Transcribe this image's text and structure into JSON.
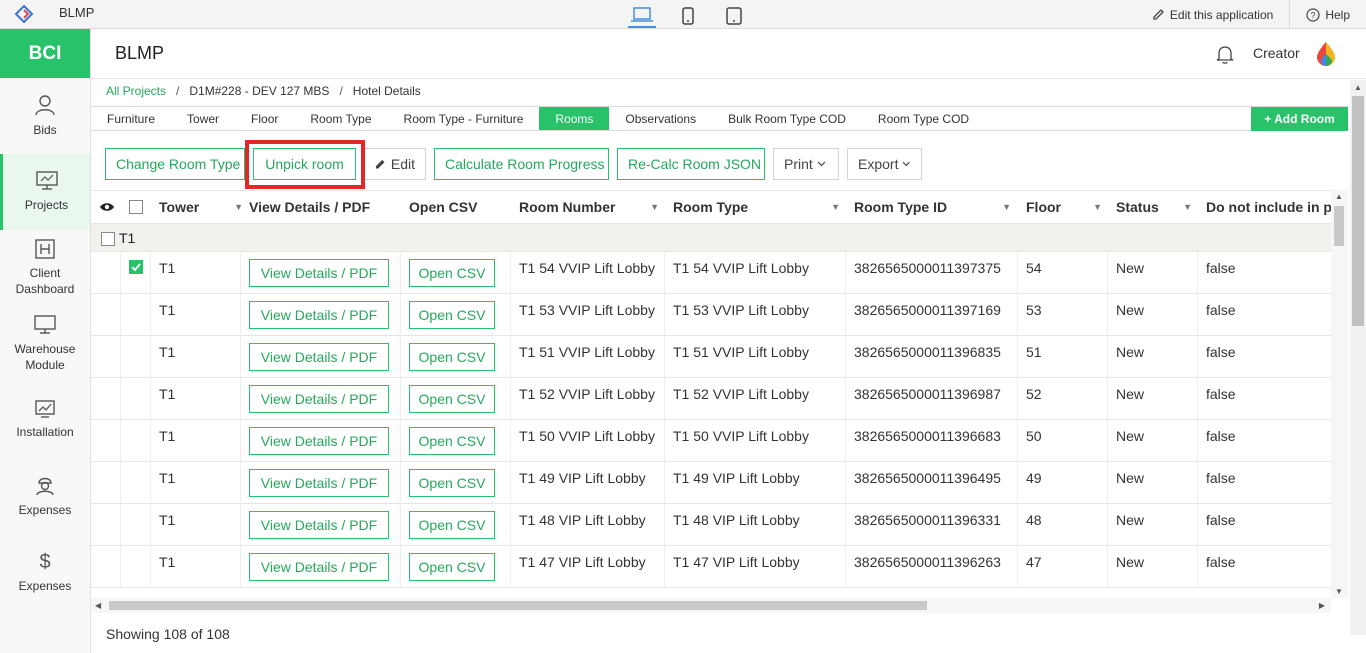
{
  "app": {
    "name": "BLMP"
  },
  "topbar": {
    "edit_label": "Edit this application",
    "help_label": "Help"
  },
  "sidebar": {
    "brand": "BCI",
    "items": [
      {
        "label": "Bids",
        "icon": "user-icon"
      },
      {
        "label": "Projects",
        "icon": "monitor-icon",
        "active": true
      },
      {
        "label": "Client\nDashboard",
        "icon": "h-box-icon"
      },
      {
        "label": "Warehouse\nModule",
        "icon": "monitor-icon"
      },
      {
        "label": "Installation",
        "icon": "chart-icon"
      },
      {
        "label": "Expenses",
        "icon": "worker-icon"
      },
      {
        "label": "Expenses",
        "icon": "dollar-icon"
      }
    ]
  },
  "header": {
    "title": "BLMP",
    "user": "Creator"
  },
  "breadcrumb": {
    "root": "All Projects",
    "project": "D1M#228 - DEV 127 MBS",
    "page": "Hotel Details"
  },
  "tabs": [
    "Furniture",
    "Tower",
    "Floor",
    "Room Type",
    "Room Type - Furniture",
    "Rooms",
    "Observations",
    "Bulk Room Type COD",
    "Room Type COD"
  ],
  "active_tab": "Rooms",
  "add_room_label": "+ Add Room",
  "toolbar": {
    "change_room_type": "Change Room Type",
    "unpick_room": "Unpick room",
    "edit": "Edit",
    "calculate_progress": "Calculate Room Progress",
    "recalc_json": "Re-Calc Room JSON",
    "print": "Print",
    "export": "Export"
  },
  "grid": {
    "columns": [
      "Tower",
      "View Details / PDF",
      "Open CSV",
      "Room Number",
      "Room Type",
      "Room Type ID",
      "Floor",
      "Status",
      "Do not include in pe"
    ],
    "group_label": "T1",
    "view_btn": "View Details / PDF",
    "csv_btn": "Open CSV",
    "rows": [
      {
        "tower": "T1",
        "room_number": "T1 54 VVIP Lift Lobby",
        "room_type": "T1 54 VVIP Lift Lobby",
        "room_type_id": "3826565000011397375",
        "floor": "54",
        "status": "New",
        "exclude": "false",
        "checked": true
      },
      {
        "tower": "T1",
        "room_number": "T1 53 VVIP Lift Lobby",
        "room_type": "T1 53 VVIP Lift Lobby",
        "room_type_id": "3826565000011397169",
        "floor": "53",
        "status": "New",
        "exclude": "false"
      },
      {
        "tower": "T1",
        "room_number": "T1 51 VVIP Lift Lobby",
        "room_type": "T1 51 VVIP Lift Lobby",
        "room_type_id": "3826565000011396835",
        "floor": "51",
        "status": "New",
        "exclude": "false"
      },
      {
        "tower": "T1",
        "room_number": "T1 52 VVIP Lift Lobby",
        "room_type": "T1 52 VVIP Lift Lobby",
        "room_type_id": "3826565000011396987",
        "floor": "52",
        "status": "New",
        "exclude": "false"
      },
      {
        "tower": "T1",
        "room_number": "T1 50 VVIP Lift Lobby",
        "room_type": "T1 50 VVIP Lift Lobby",
        "room_type_id": "3826565000011396683",
        "floor": "50",
        "status": "New",
        "exclude": "false"
      },
      {
        "tower": "T1",
        "room_number": "T1 49 VIP Lift Lobby",
        "room_type": "T1 49 VIP Lift Lobby",
        "room_type_id": "3826565000011396495",
        "floor": "49",
        "status": "New",
        "exclude": "false"
      },
      {
        "tower": "T1",
        "room_number": "T1 48 VIP Lift Lobby",
        "room_type": "T1 48 VIP Lift Lobby",
        "room_type_id": "3826565000011396331",
        "floor": "48",
        "status": "New",
        "exclude": "false"
      },
      {
        "tower": "T1",
        "room_number": "T1 47 VIP Lift Lobby",
        "room_type": "T1 47 VIP Lift Lobby",
        "room_type_id": "3826565000011396263",
        "floor": "47",
        "status": "New",
        "exclude": "false"
      }
    ]
  },
  "footer": {
    "showing": "Showing 108 of 108"
  },
  "colors": {
    "accent": "#27c26a",
    "highlight": "#e32626"
  }
}
